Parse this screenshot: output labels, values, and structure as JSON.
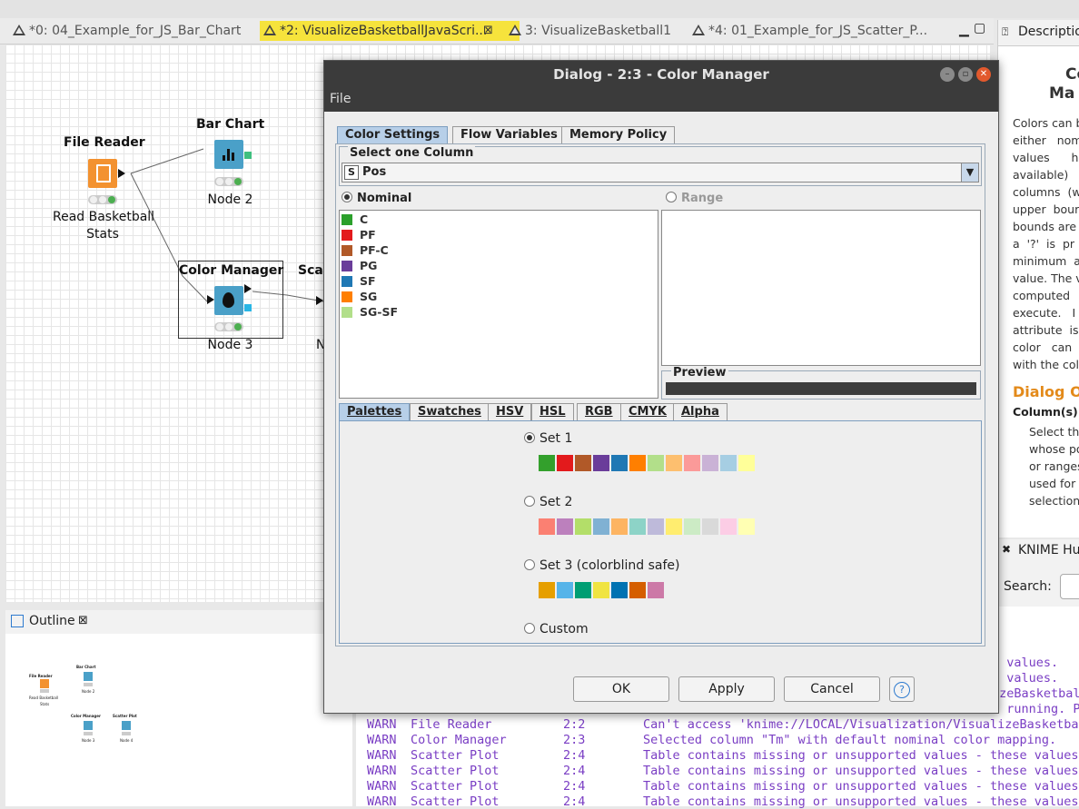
{
  "editor_tabs": [
    {
      "label": "*0: 04_Example_for_JS_Bar_Chart",
      "active": false
    },
    {
      "label": "*2: VisualizeBasketballJavaScri...",
      "active": true
    },
    {
      "label": "3: VisualizeBasketball1",
      "active": false
    },
    {
      "label": "*4: 01_Example_for_JS_Scatter_P...",
      "active": false
    }
  ],
  "workflow": {
    "file_reader": {
      "title": "File Reader",
      "sub1": "Read Basketball",
      "sub2": "Stats"
    },
    "bar_chart": {
      "title": "Bar Chart",
      "sub": "Node 2"
    },
    "color_manager": {
      "title": "Color Manager",
      "sub": "Node 3"
    },
    "scatter": {
      "title": "Scat",
      "sub": "N"
    }
  },
  "outline": {
    "title": "Outline",
    "mini_labels": {
      "file_reader": "File Reader",
      "read": "Read Basketball",
      "stats": "Stats",
      "bar_chart": "Bar Chart",
      "node2": "Node 2",
      "color_manager": "Color Manager",
      "node3": "Node 3",
      "scatter": "Scatter Plot",
      "node4": "Node 4"
    }
  },
  "description": {
    "tab": "Description",
    "heading1": "Co",
    "heading2": "Ma",
    "lines": [
      "Colors can b",
      "either   nom",
      "values      ha",
      "available)",
      "columns  (w",
      "upper  bour",
      "bounds are",
      "a  '?'  is  pr",
      "minimum  a",
      "value. The v",
      "computed",
      "execute.   I",
      "attribute  is",
      "color   can",
      "with the colo"
    ],
    "dialog_heading": "Dialog O",
    "column_label": "Column(s):",
    "column_lines": [
      "Select the",
      "whose po",
      "or ranges",
      "used for c",
      "selection."
    ]
  },
  "hub": {
    "title": "KNIME Hu",
    "search_label": "Search:"
  },
  "dialog": {
    "title": "Dialog - 2:3 - Color Manager",
    "menu": "File",
    "tabs": [
      "Color Settings",
      "Flow Variables",
      "Memory Policy"
    ],
    "select_column_label": "Select one Column",
    "column_type": "S",
    "column_value": "Pos",
    "nominal_label": "Nominal",
    "range_label": "Range",
    "preview_label": "Preview",
    "nominal_values": [
      {
        "name": "C",
        "color": "#2ca02c"
      },
      {
        "name": "PF",
        "color": "#e31a1c"
      },
      {
        "name": "PF-C",
        "color": "#b15928"
      },
      {
        "name": "PG",
        "color": "#6a3d9a"
      },
      {
        "name": "SF",
        "color": "#1f78b4"
      },
      {
        "name": "SG",
        "color": "#ff7f00"
      },
      {
        "name": "SG-SF",
        "color": "#b2df8a"
      }
    ],
    "palette_tabs": [
      "Palettes",
      "Swatches",
      "HSV",
      "HSL",
      "RGB",
      "CMYK",
      "Alpha"
    ],
    "set1_label": "Set 1",
    "set2_label": "Set 2",
    "set3_label": "Set 3 (colorblind safe)",
    "custom_label": "Custom",
    "set1": [
      "#33a02c",
      "#e31a1c",
      "#b15928",
      "#6a3d9a",
      "#1f78b4",
      "#ff7f00",
      "#b2df8a",
      "#fdbf6f",
      "#fb9a99",
      "#cab2d6",
      "#a6cee3",
      "#ffff99"
    ],
    "set2": [
      "#fb8072",
      "#bc80bd",
      "#b3de69",
      "#80b1d3",
      "#fdb462",
      "#8dd3c7",
      "#bebada",
      "#ffed6f",
      "#ccebc5",
      "#d9d9d9",
      "#fccde5",
      "#ffffb3"
    ],
    "set3": [
      "#e69f00",
      "#56b4e9",
      "#009e73",
      "#f0e442",
      "#0072b2",
      "#d55e00",
      "#cc79a7"
    ],
    "buttons": {
      "ok": "OK",
      "apply": "Apply",
      "cancel": "Cancel",
      "help": "?"
    }
  },
  "console": {
    "partial": [
      "l values.",
      "l values.",
      "izeBasketbal",
      "r running. P"
    ],
    "rows": [
      {
        "level": "WARN",
        "node": "File Reader",
        "id": "2:2",
        "msg": "Can't access 'knime://LOCAL/Visualization/VisualizeBasketbal"
      },
      {
        "level": "WARN",
        "node": "Color Manager",
        "id": "2:3",
        "msg": "Selected column \"Tm\" with default nominal color mapping."
      },
      {
        "level": "WARN",
        "node": "Scatter Plot",
        "id": "2:4",
        "msg": "Table contains missing or unsupported values - these values"
      },
      {
        "level": "WARN",
        "node": "Scatter Plot",
        "id": "2:4",
        "msg": "Table contains missing or unsupported values - these values"
      },
      {
        "level": "WARN",
        "node": "Scatter Plot",
        "id": "2:4",
        "msg": "Table contains missing or unsupported values - these values"
      },
      {
        "level": "WARN",
        "node": "Scatter Plot",
        "id": "2:4",
        "msg": "Table contains missing or unsupported values - these values"
      }
    ]
  }
}
